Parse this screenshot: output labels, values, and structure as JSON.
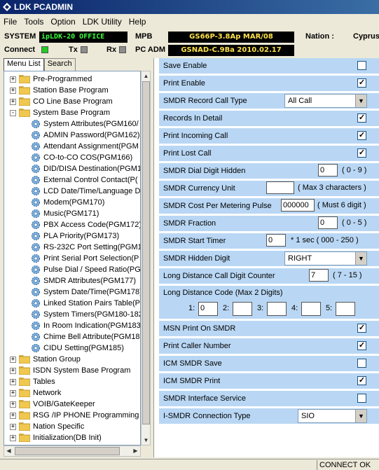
{
  "window": {
    "title": "LDK PCADMIN"
  },
  "menu": [
    "File",
    "Tools",
    "Option",
    "LDK Utility",
    "Help"
  ],
  "info": {
    "system_label": "SYSTEM",
    "system_value": "ipLDK-20 OFFICE",
    "mpb_label": "MPB",
    "mpb_value": "GS66P-3.8Ap MAR/08",
    "nation_label": "Nation :",
    "nation_value": "Cyprus",
    "connect_label": "Connect",
    "tx_label": "Tx",
    "rx_label": "Rx",
    "pcadm_label": "PC ADM",
    "pcadm_value": "GSNAD-C.9Ba 2010.02.17",
    "colors": {
      "connect_led": "#22cc22",
      "tx_led": "#8c8c8c",
      "rx_led": "#8c8c8c"
    }
  },
  "tabs": [
    "Menu List",
    "Search"
  ],
  "tree": [
    {
      "label": "Pre-Programmed",
      "level": 0,
      "expander": "+"
    },
    {
      "label": "Station Base Program",
      "level": 0,
      "expander": "+"
    },
    {
      "label": "CO Line Base Program",
      "level": 0,
      "expander": "+"
    },
    {
      "label": "System Base Program",
      "level": 0,
      "expander": "-"
    },
    {
      "label": "System Attributes(PGM160/",
      "level": 1
    },
    {
      "label": "ADMIN Password(PGM162)",
      "level": 1
    },
    {
      "label": "Attendant Assignment(PGM",
      "level": 1
    },
    {
      "label": "CO-to-CO COS(PGM166)",
      "level": 1
    },
    {
      "label": "DID/DISA Destination(PGM1",
      "level": 1
    },
    {
      "label": "External Control Contact(P(",
      "level": 1
    },
    {
      "label": "LCD Date/Time/Language D",
      "level": 1
    },
    {
      "label": "Modem(PGM170)",
      "level": 1
    },
    {
      "label": "Music(PGM171)",
      "level": 1
    },
    {
      "label": "PBX Access Code(PGM172)",
      "level": 1
    },
    {
      "label": "PLA Priority(PGM173)",
      "level": 1
    },
    {
      "label": "RS-232C Port Setting(PGM1",
      "level": 1
    },
    {
      "label": "Print Serial Port Selection(P",
      "level": 1
    },
    {
      "label": "Pulse Dial / Speed Ratio(PG",
      "level": 1
    },
    {
      "label": "SMDR Attributes(PGM177)",
      "level": 1
    },
    {
      "label": "System Date/Time(PGM178)",
      "level": 1
    },
    {
      "label": "Linked Station Pairs Table(P",
      "level": 1
    },
    {
      "label": "System Timers(PGM180-182",
      "level": 1
    },
    {
      "label": "In Room Indication(PGM183",
      "level": 1
    },
    {
      "label": "Chime Bell Attribute(PGM18",
      "level": 1
    },
    {
      "label": "CIDU Setting(PGM185)",
      "level": 1
    },
    {
      "label": "Station Group",
      "level": 0,
      "expander": "+"
    },
    {
      "label": "ISDN System Base Program",
      "level": 0,
      "expander": "+"
    },
    {
      "label": "Tables",
      "level": 0,
      "expander": "+"
    },
    {
      "label": "Network",
      "level": 0,
      "expander": "+"
    },
    {
      "label": "VOIB/GateKeeper",
      "level": 0,
      "expander": "+"
    },
    {
      "label": "RSG /IP PHONE Programming",
      "level": 0,
      "expander": "+"
    },
    {
      "label": "Nation Specific",
      "level": 0,
      "expander": "+"
    },
    {
      "label": "Initialization(DB Init)",
      "level": 0,
      "expander": "+"
    }
  ],
  "settings": {
    "save_enable": {
      "label": "Save Enable",
      "checked": ""
    },
    "print_enable": {
      "label": "Print Enable",
      "checked": "✓"
    },
    "smdr_record_call_type": {
      "label": "SMDR Record Call Type",
      "value": "All Call"
    },
    "records_in_detail": {
      "label": "Records In Detail",
      "checked": "✓"
    },
    "print_incoming_call": {
      "label": "Print Incoming Call",
      "checked": "✓"
    },
    "print_lost_call": {
      "label": "Print Lost Call",
      "checked": "✓"
    },
    "smdr_dial_digit_hidden": {
      "label": "SMDR Dial Digit Hidden",
      "value": "0",
      "range": "( 0 - 9 )"
    },
    "smdr_currency_unit": {
      "label": "SMDR Currency Unit",
      "value": "",
      "range": "( Max 3 characters )"
    },
    "smdr_cost_per_metering_pulse": {
      "label": "SMDR Cost Per Metering Pulse",
      "value": "000000",
      "range": "( Must 6 digit )"
    },
    "smdr_fraction": {
      "label": "SMDR Fraction",
      "value": "0",
      "range": "( 0 - 5 )"
    },
    "smdr_start_timer": {
      "label": "SMDR Start Timer",
      "value": "0",
      "range": "* 1 sec  ( 000 - 250 )"
    },
    "smdr_hidden_digit": {
      "label": "SMDR Hidden Digit",
      "value": "RIGHT"
    },
    "long_distance_call_digit_counter": {
      "label": "Long Distance Call Digit Counter",
      "value": "7",
      "range": "( 7 - 15 )"
    },
    "long_distance_code": {
      "label": "Long Distance Code  (Max 2 Digits)",
      "fields": [
        {
          "label": "1:",
          "value": "0"
        },
        {
          "label": "2:",
          "value": ""
        },
        {
          "label": "3:",
          "value": ""
        },
        {
          "label": "4:",
          "value": ""
        },
        {
          "label": "5:",
          "value": ""
        }
      ]
    },
    "msn_print_on_smdr": {
      "label": "MSN Print On SMDR",
      "checked": "✓"
    },
    "print_caller_number": {
      "label": "Print Caller Number",
      "checked": "✓"
    },
    "icm_smdr_save": {
      "label": "ICM SMDR Save",
      "checked": ""
    },
    "icm_smdr_print": {
      "label": "ICM SMDR Print",
      "checked": "✓"
    },
    "smdr_interface_service": {
      "label": "SMDR Interface Service",
      "checked": ""
    },
    "i_smdr_connection_type": {
      "label": "I-SMDR Connection Type",
      "value": "SIO"
    }
  },
  "status": {
    "text": "CONNECT OK"
  }
}
